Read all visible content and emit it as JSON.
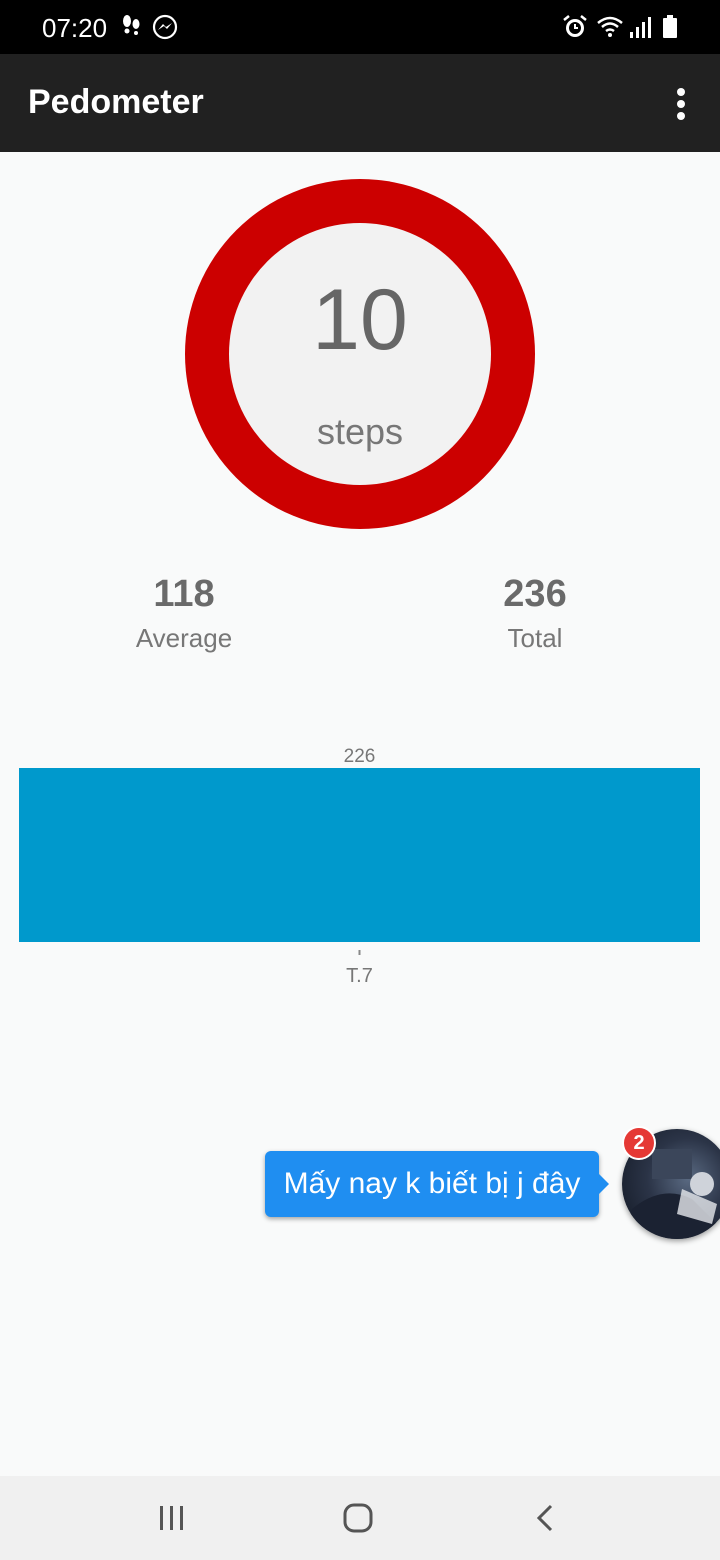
{
  "status_bar": {
    "time": "07:20",
    "left_icons": [
      "footsteps-icon",
      "messenger-icon"
    ],
    "right_icons": [
      "alarm-icon",
      "wifi-icon",
      "signal-icon",
      "battery-icon"
    ]
  },
  "app_bar": {
    "title": "Pedometer",
    "menu_icon": "overflow-menu-icon"
  },
  "today": {
    "steps": "10",
    "unit": "steps",
    "ring_color": "#cc0000",
    "progress_fraction": 1.0
  },
  "stats": {
    "average_value": "118",
    "average_label": "Average",
    "total_value": "236",
    "total_label": "Total"
  },
  "chart_data": {
    "type": "bar",
    "categories": [
      "T.7"
    ],
    "values": [
      226
    ],
    "data_labels": [
      "226"
    ],
    "bar_color": "#0099cc",
    "title": "",
    "xlabel": "",
    "ylabel": "",
    "grid": false,
    "legend": "none"
  },
  "chat_head": {
    "message": "Mấy nay k biết bị j đây",
    "unread_count": "2",
    "bubble_color": "#1f8ef1",
    "badge_color": "#e53935"
  },
  "nav_bar": {
    "buttons": [
      "recent-apps-icon",
      "home-icon",
      "back-icon"
    ]
  }
}
